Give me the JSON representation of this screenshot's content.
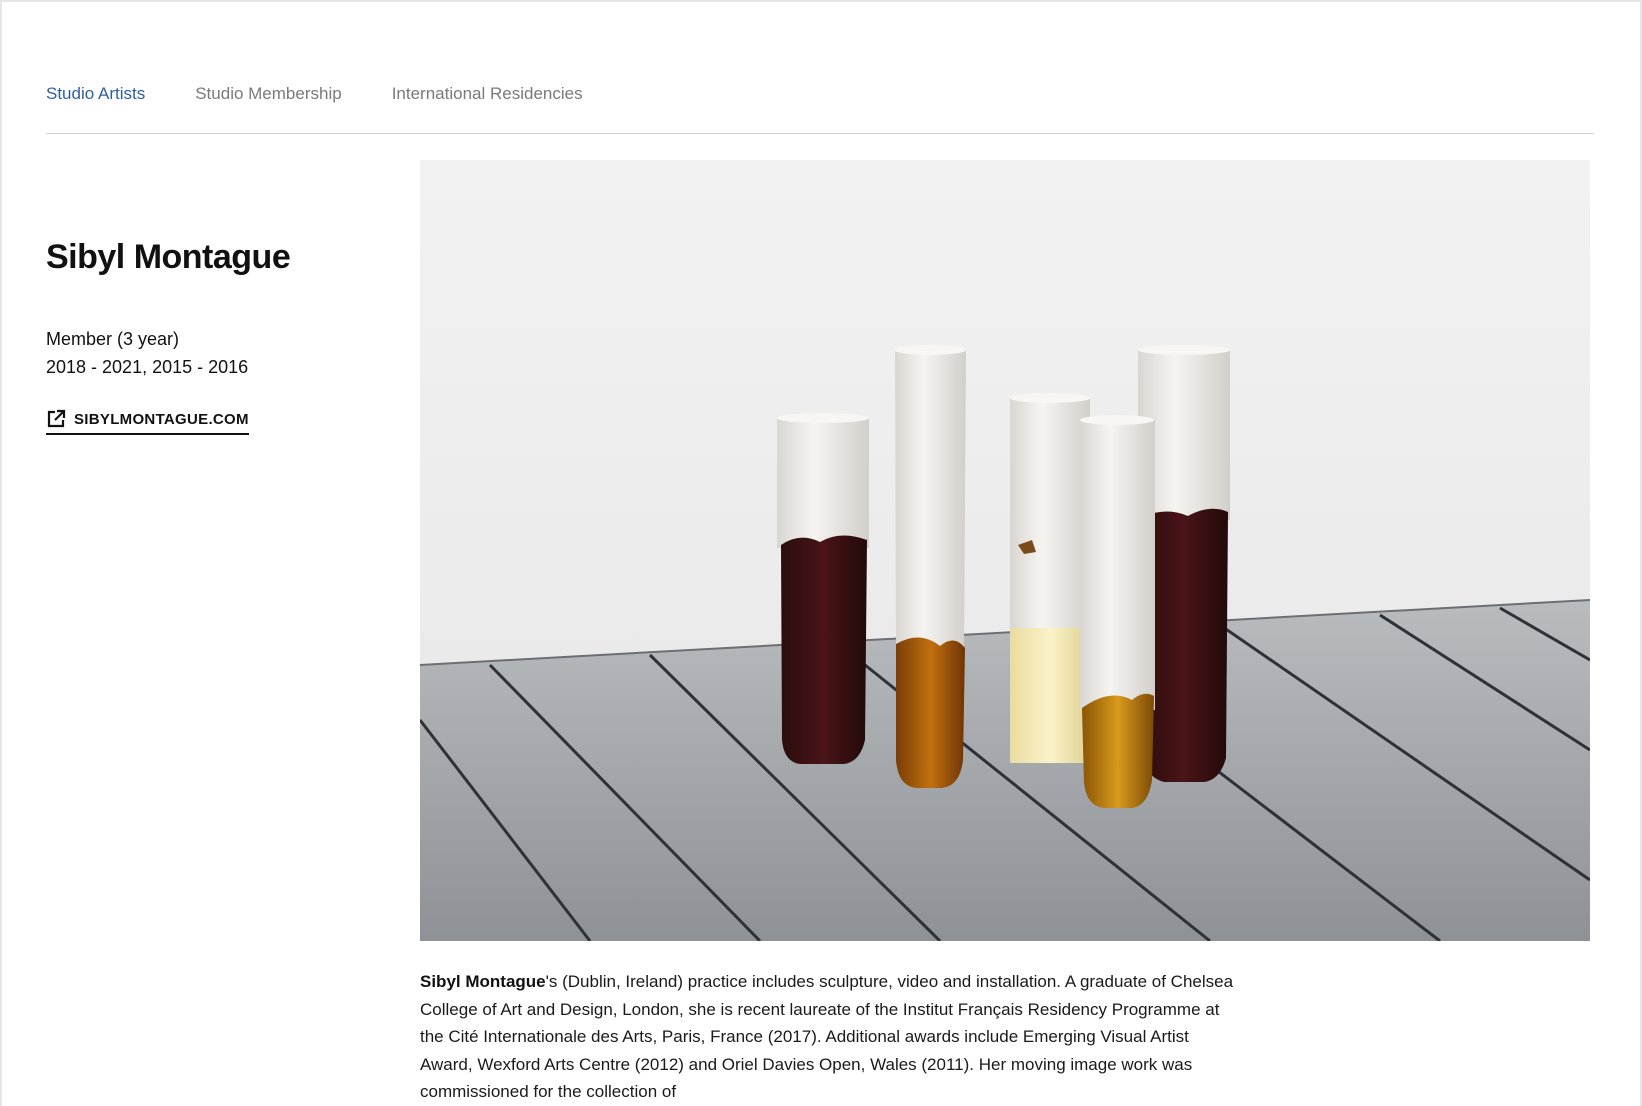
{
  "tabs": [
    {
      "label": "Studio Artists",
      "active": true
    },
    {
      "label": "Studio Membership",
      "active": false
    },
    {
      "label": "International Residencies",
      "active": false
    }
  ],
  "artist": {
    "name": "Sibyl Montague",
    "membership": "Member (3 year)",
    "years": "2018 - 2021, 2015 - 2016",
    "website_label": "SIBYLMONTAGUE.COM"
  },
  "bio": {
    "lead_name": "Sibyl Montague",
    "text": "'s (Dublin, Ireland) practice includes sculpture, video and installation. A graduate of Chelsea College of Art and Design, London, she is recent laureate of the Institut Français Residency Programme at the Cité Internationale des Arts, Paris, France (2017). Additional awards include Emerging Visual Artist Award, Wexford Arts Centre (2012) and Oriel Davies Open, Wales (2011). Her moving image work was commissioned for the collection of"
  },
  "colors": {
    "active_tab": "#2f5f9e",
    "inactive_tab": "#7a7a7a",
    "text": "#111111"
  },
  "icons": {
    "website": "external-link-icon"
  }
}
